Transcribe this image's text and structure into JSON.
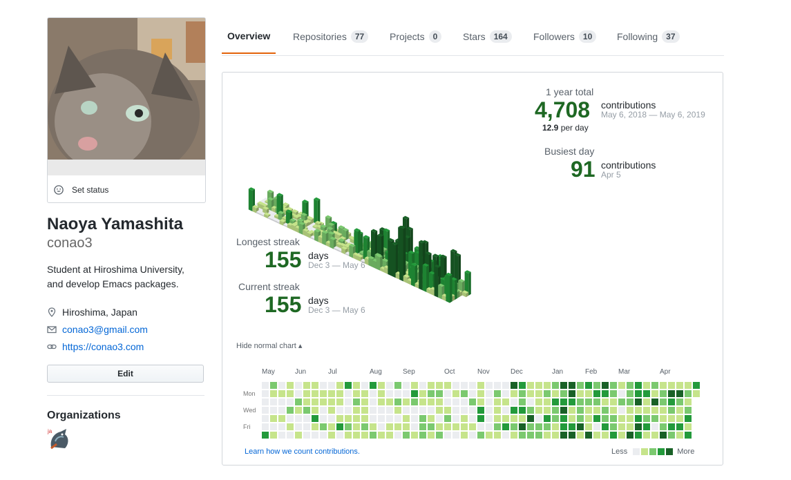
{
  "profile": {
    "fullname": "Naoya Yamashita",
    "username": "conao3",
    "status_label": "Set status",
    "bio_line1": "Student at Hiroshima University,",
    "bio_line2": "and develop Emacs packages.",
    "location": "Hiroshima, Japan",
    "email": "conao3@gmail.com",
    "website": "https://conao3.com",
    "edit_label": "Edit",
    "organizations_title": "Organizations",
    "org_badge": "ja"
  },
  "tabs": [
    {
      "label": "Overview",
      "count": null
    },
    {
      "label": "Repositories",
      "count": "77"
    },
    {
      "label": "Projects",
      "count": "0"
    },
    {
      "label": "Stars",
      "count": "164"
    },
    {
      "label": "Followers",
      "count": "10"
    },
    {
      "label": "Following",
      "count": "37"
    }
  ],
  "stats": {
    "total_label": "1 year total",
    "total_value": "4,708",
    "total_unit": "contributions",
    "total_range": "May 6, 2018 — May 6, 2019",
    "per_day_value": "12.9",
    "per_day_label": "per day",
    "busiest_label": "Busiest day",
    "busiest_value": "91",
    "busiest_unit": "contributions",
    "busiest_date": "Apr 5",
    "longest_label": "Longest streak",
    "longest_value": "155",
    "longest_unit": "days",
    "longest_range": "Dec 3 — May 6",
    "current_label": "Current streak",
    "current_value": "155",
    "current_unit": "days",
    "current_range": "Dec 3 — May 6"
  },
  "calendar": {
    "hide_label": "Hide normal chart ▴",
    "months": [
      "May",
      "Jun",
      "Jul",
      "Aug",
      "Sep",
      "Oct",
      "Nov",
      "Dec",
      "Jan",
      "Feb",
      "Mar",
      "Apr"
    ],
    "day_labels": [
      "Mon",
      "Wed",
      "Fri"
    ],
    "learn_link": "Learn how we count contributions.",
    "legend_less": "Less",
    "legend_more": "More"
  },
  "colors": {
    "level0": "#ebedf0",
    "level1": "#c6e48b",
    "level2": "#7bc96f",
    "level3": "#239a3b",
    "level4": "#196127",
    "accent_tab": "#e36209",
    "link": "#0366d6"
  }
}
